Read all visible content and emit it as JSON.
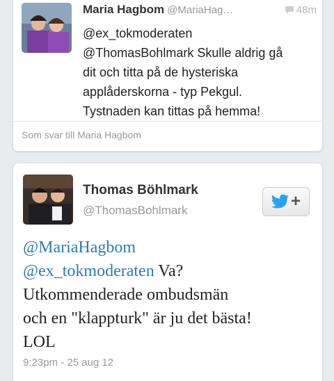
{
  "tweet1": {
    "name": "Maria Hagbom",
    "handle": "@MariaHag…",
    "time": "48m",
    "lines": [
      "@ex_tokmoderaten",
      "@ThomasBohlmark Skulle aldrig gå",
      "dit och titta på de hysteriska",
      "applåderskorna - typ Pekgul.",
      "Tystnaden kan tittas på hemma!"
    ],
    "in_reply_to": "Som svar till Maria Hagbom"
  },
  "tweet2": {
    "name": "Thomas Böhlmark",
    "handle": "@ThomasBohlmark",
    "mention1": "@MariaHagbom",
    "mention2": "@ex_tokmoderaten",
    "text_after_mention2": " Va?",
    "line3": "Utkommenderade ombudsmän",
    "line4": "och en \"klappturk\" är ju det bästa!",
    "line5": "LOL",
    "timestamp": "9:23pm - 25 aug 12"
  },
  "follow_button": {
    "icon": "twitter-bird-icon",
    "label": "+"
  },
  "colors": {
    "mention": "#2b7bb9",
    "twitter_blue": "#2aa3ef",
    "background": "#e9ecee"
  }
}
